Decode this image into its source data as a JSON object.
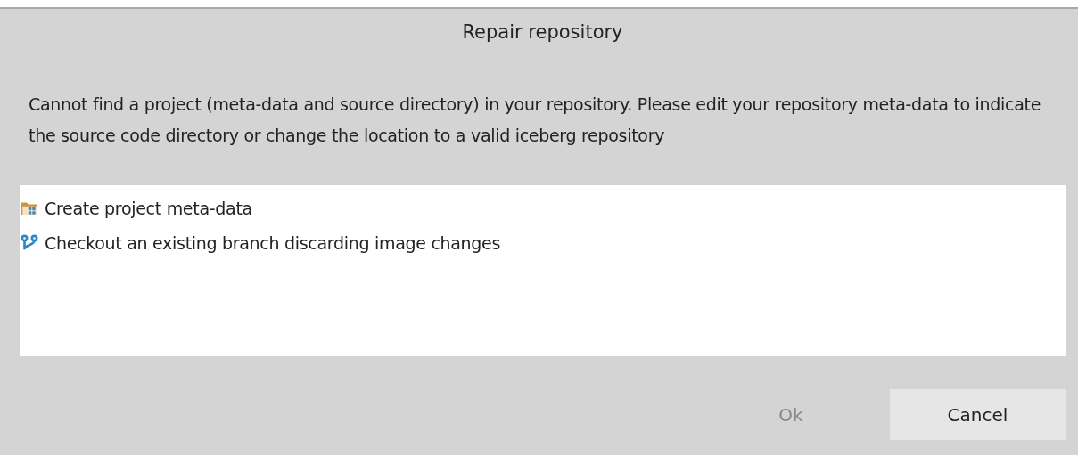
{
  "window": {
    "title": "Repair repository"
  },
  "message": "Cannot find a project (meta-data and source directory) in your repository. Please edit your repository meta-data to indicate the source code directory or change the location to a valid iceberg repository",
  "options": [
    {
      "kind": "project",
      "label": "Create project meta-data"
    },
    {
      "kind": "branch",
      "label": "Checkout an existing branch discarding image changes"
    }
  ],
  "buttons": [
    {
      "label": "Ok",
      "disabled": true
    },
    {
      "label": "Cancel",
      "disabled": false
    }
  ]
}
